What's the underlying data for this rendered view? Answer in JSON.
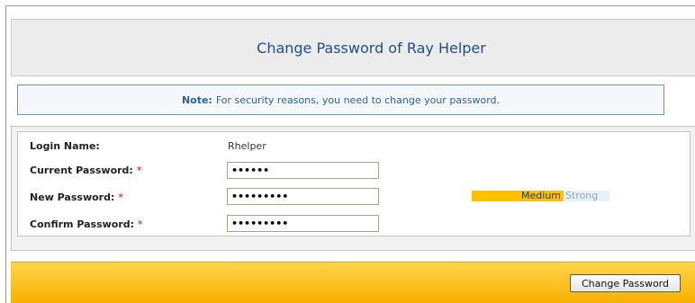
{
  "header": {
    "title": "Change Password of Ray Helper"
  },
  "note": {
    "label": "Note:",
    "text": "For security reasons, you need to change your password."
  },
  "form": {
    "login_name_label": "Login Name:",
    "login_name_value": "Rhelper",
    "current_password_label": "Current Password:",
    "current_password_value": "••••••",
    "new_password_label": "New Password:",
    "new_password_value": "•••••••••",
    "confirm_password_label": "Confirm Password:",
    "confirm_password_value": "•••••••••",
    "required_marker": "*"
  },
  "strength_meter": {
    "medium_label": "Medium",
    "strong_label": "Strong",
    "level": "Medium"
  },
  "footer": {
    "submit_label": "Change Password"
  },
  "colors": {
    "title_text": "#1f4e8c",
    "note_text": "#2a61a1",
    "required": "#d40000",
    "footer_bar": "#f8b000",
    "meter_medium": "#ffc000"
  }
}
